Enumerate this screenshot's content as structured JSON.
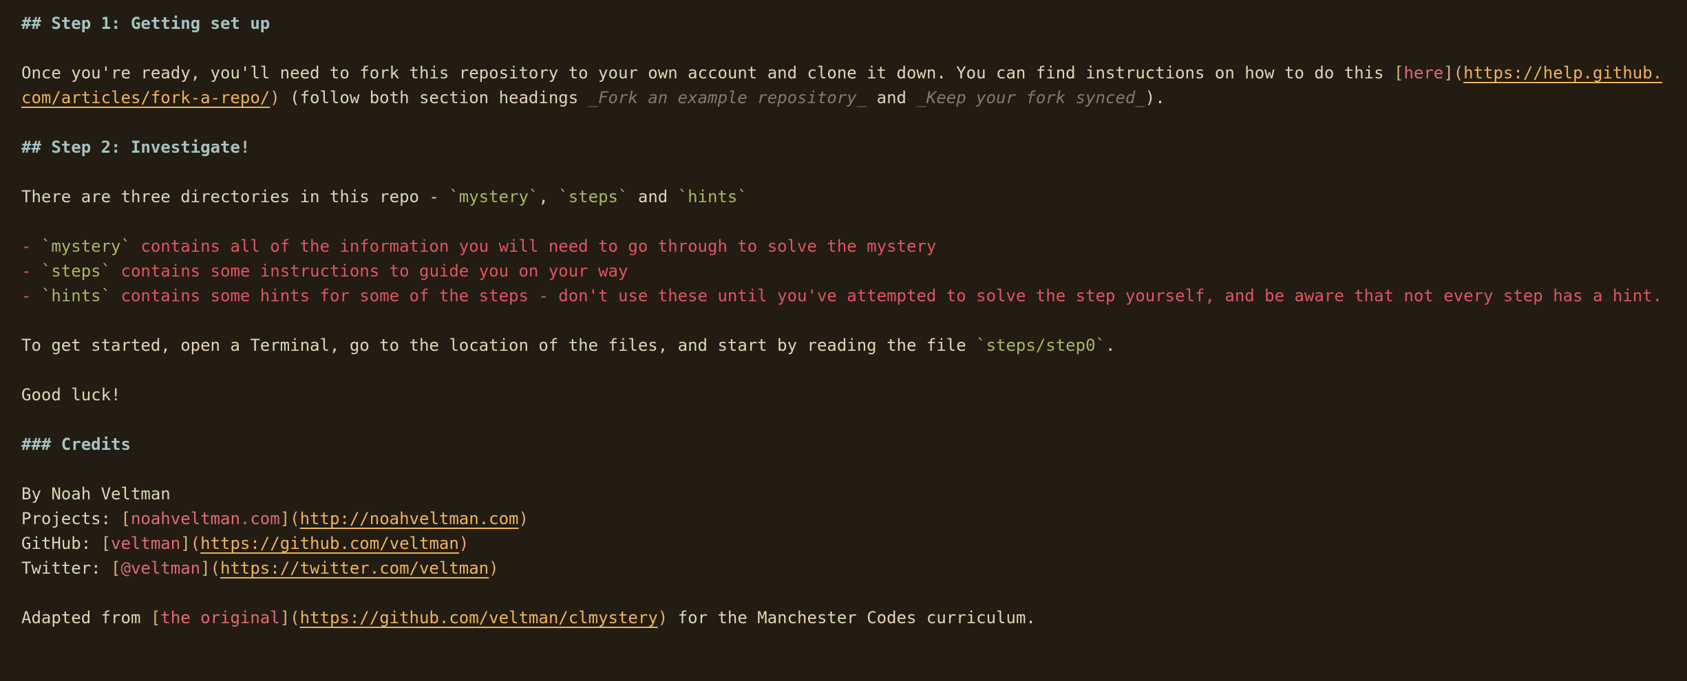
{
  "step1": {
    "heading": "## Step 1: Getting set up",
    "p1_text": "Once you're ready, you'll need to fork this repository to your own account and clone it down. You can find instructions on how to do this ",
    "p1_link_text": "here",
    "p1_url_part1": "https://help.github.",
    "p1_url_part2": "com/articles/fork-a-repo/",
    "p1_text2": " (follow both section headings ",
    "p1_italic1": "_Fork an example repository_",
    "p1_and": " and ",
    "p1_italic2": "_Keep your fork synced_",
    "p1_end": ")."
  },
  "step2": {
    "heading": "## Step 2: Investigate!",
    "intro": "There are three directories in this repo - ",
    "dir1": "`mystery`",
    "sep1": ", ",
    "dir2": "`steps`",
    "and": " and ",
    "dir3": "`hints`",
    "items": [
      {
        "dash": "- ",
        "code": "`mystery`",
        "text": " contains all of the information you will need to go through to solve the mystery"
      },
      {
        "dash": "- ",
        "code": "`steps`",
        "text": " contains some instructions to guide you on your way"
      },
      {
        "dash": "- ",
        "code": "`hints`",
        "text": " contains some hints for some of the steps - don't use these until you've attempted to solve the step yourself, and be aware that not every step has a hint."
      }
    ],
    "start_text": "To get started, open a Terminal, go to the location of the files, and start by reading the file ",
    "start_code": "`steps/step0`",
    "start_end": ".",
    "good_luck": "Good luck!"
  },
  "credits": {
    "heading": "### Credits",
    "by": "By Noah Veltman",
    "projects_label": "Projects: ",
    "projects_link": "noahveltman.com",
    "projects_url": "http://noahveltman.com",
    "github_label": "GitHub: ",
    "github_link": "veltman",
    "github_url": "https://github.com/veltman",
    "twitter_label": "Twitter: ",
    "twitter_link": "@veltman",
    "twitter_url": "https://twitter.com/veltman",
    "adapted_label": "Adapted from ",
    "adapted_link": "the original",
    "adapted_url": "https://github.com/veltman/clmystery",
    "adapted_end": " for the Manchester Codes curriculum."
  },
  "colors": {
    "background": "#221c12",
    "heading": "#a6c3c1",
    "text": "#e3d3b8",
    "code": "#a9b665",
    "list": "#e05561",
    "url": "#f0b35a"
  }
}
